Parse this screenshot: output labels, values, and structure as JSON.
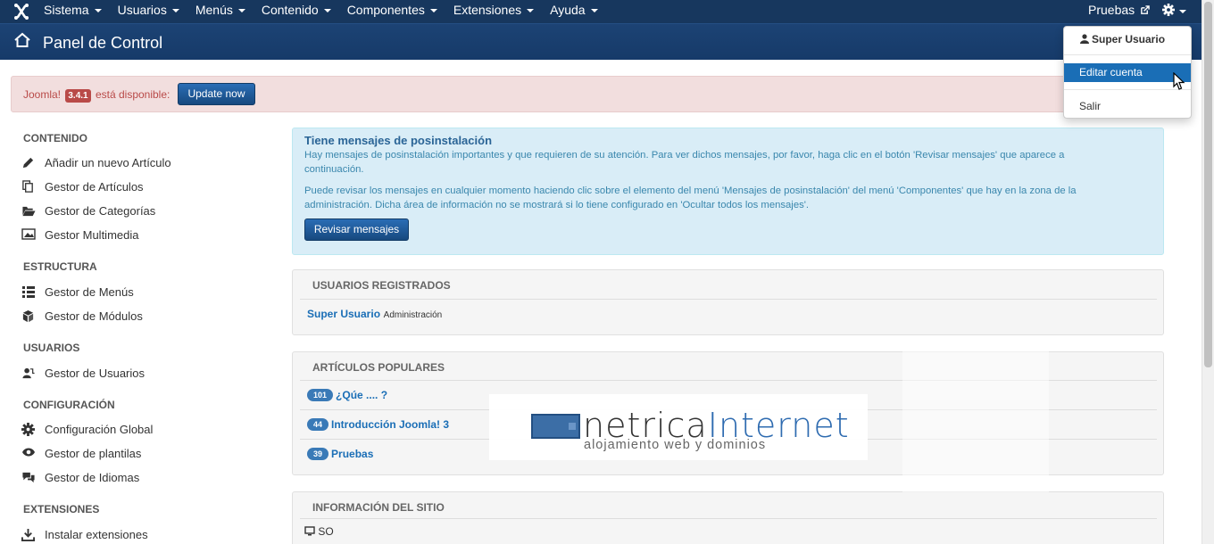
{
  "nav": {
    "menu": [
      "Sistema",
      "Usuarios",
      "Menús",
      "Contenido",
      "Componentes",
      "Extensiones",
      "Ayuda"
    ],
    "site_link": "Pruebas"
  },
  "header": {
    "title": "Panel de Control"
  },
  "update": {
    "prefix": "Joomla!",
    "version": "3.4.1",
    "suffix": "está disponible:",
    "button": "Update now"
  },
  "sidebar": {
    "sections": [
      {
        "title": "CONTENIDO",
        "items": [
          {
            "icon": "pencil-icon",
            "label": "Añadir un nuevo Artículo"
          },
          {
            "icon": "copy-icon",
            "label": "Gestor de Artículos"
          },
          {
            "icon": "folder-open-icon",
            "label": "Gestor de Categorías"
          },
          {
            "icon": "image-icon",
            "label": "Gestor Multimedia"
          }
        ]
      },
      {
        "title": "ESTRUCTURA",
        "items": [
          {
            "icon": "list-icon",
            "label": "Gestor de Menús"
          },
          {
            "icon": "cube-icon",
            "label": "Gestor de Módulos"
          }
        ]
      },
      {
        "title": "USUARIOS",
        "items": [
          {
            "icon": "users-icon",
            "label": "Gestor de Usuarios"
          }
        ]
      },
      {
        "title": "CONFIGURACIÓN",
        "items": [
          {
            "icon": "cog-icon",
            "label": "Configuración Global"
          },
          {
            "icon": "eye-icon",
            "label": "Gestor de plantilas"
          },
          {
            "icon": "comments-icon",
            "label": "Gestor de Idiomas"
          }
        ]
      },
      {
        "title": "EXTENSIONES",
        "items": [
          {
            "icon": "download-icon",
            "label": "Instalar extensiones"
          }
        ]
      }
    ]
  },
  "postinstall": {
    "title": "Tiene mensajes de posinstalación",
    "p1": "Hay mensajes de posinstalación importantes y que requieren de su atención. Para ver dichos mensajes, por favor, haga clic en el botón 'Revisar mensajes' que aparece a continuación.",
    "p2": "Puede revisar los mensajes en cualquier momento haciendo clic sobre el elemento del menú 'Mensajes de posinstalación' del menú 'Componentes' que hay en la zona de la administración. Dicha área de información no se mostrará si lo tiene configurado en 'Ocultar todos los mensajes'.",
    "button": "Revisar mensajes"
  },
  "registered": {
    "title": "USUARIOS REGISTRADOS",
    "user": "Super Usuario",
    "role": "Administración"
  },
  "popular": {
    "title": "ARTÍCULOS POPULARES",
    "items": [
      {
        "hits": "101",
        "title": "¿Qúe .... ?"
      },
      {
        "hits": "44",
        "title": "Introducción Joomla! 3"
      },
      {
        "hits": "39",
        "title": "Pruebas"
      }
    ]
  },
  "siteinfo": {
    "title": "INFORMACIÓN DEL SITIO",
    "row1": "SO"
  },
  "user_menu": {
    "user": "Super Usuario",
    "edit": "Editar cuenta",
    "logout": "Salir"
  },
  "watermark": {
    "brand_a": "netrica",
    "brand_b": "Internet",
    "tagline": "alojamiento web y dominios"
  },
  "colors": {
    "navbar": "#17375e",
    "primary_button": "#1e5b9c",
    "link": "#1a6eb6",
    "alert_bg": "#f2dede",
    "info_bg": "#d9edf7"
  }
}
